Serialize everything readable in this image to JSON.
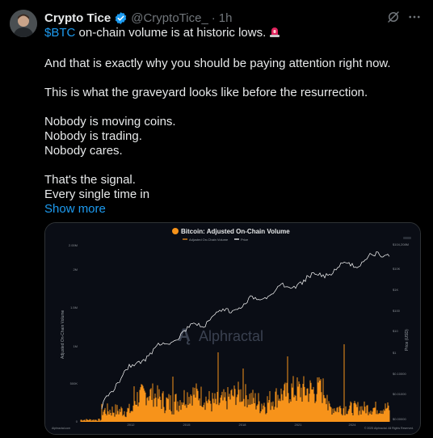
{
  "tweet": {
    "author_name": "Crypto Tice",
    "handle": "@CryptoTice_",
    "separator": "·",
    "time": "1h",
    "cashtag": "$BTC",
    "line1_rest": " on-chain volume is at historic lows.",
    "p2": "And that is exactly why you should be paying attention right now.",
    "p3": "This is what the graveyard looks like before the resurrection.",
    "p4_l1": "Nobody is moving coins.",
    "p4_l2": "Nobody is trading.",
    "p4_l3": "Nobody cares.",
    "p5_l1": "That's the signal.",
    "p5_l2": "Every single time in",
    "show_more": "Show more",
    "icons": {
      "verified": "verified-badge-icon",
      "grok": "grok-icon",
      "more": "more-options-icon",
      "siren": "siren-emoji-icon"
    },
    "colors": {
      "link": "#1d9bf0",
      "text": "#e7e9ea",
      "muted": "#71767b"
    }
  },
  "chart_data": {
    "type": "line",
    "title": "Bitcoin: Adjusted On-Chain Volume",
    "legend": [
      "Adjusted On-Chain Volume",
      "Price"
    ],
    "ylabel_left": "Adjusted On-Chain Volume",
    "ylabel_right": "Price (USD)",
    "left_ticks": [
      "2.00M",
      "2M",
      "1.5M",
      "1M",
      "500K",
      "0"
    ],
    "right_ticks": [
      "$104,208M",
      "$10K",
      "$1K",
      "$100",
      "$10",
      "$1",
      "$0.10000",
      "$0.01000",
      "$0.00000"
    ],
    "x_ticks": [
      "2012",
      "2015",
      "2018",
      "2021",
      "2024"
    ],
    "watermark": "Alphractal",
    "footer_left": "Alphractal.com",
    "footer_right": "© 2025 Alphractal. All Rights Reserved.",
    "colors": {
      "volume": "#f7931a",
      "price": "#ffffff",
      "title_badge": "#f7931a"
    }
  }
}
